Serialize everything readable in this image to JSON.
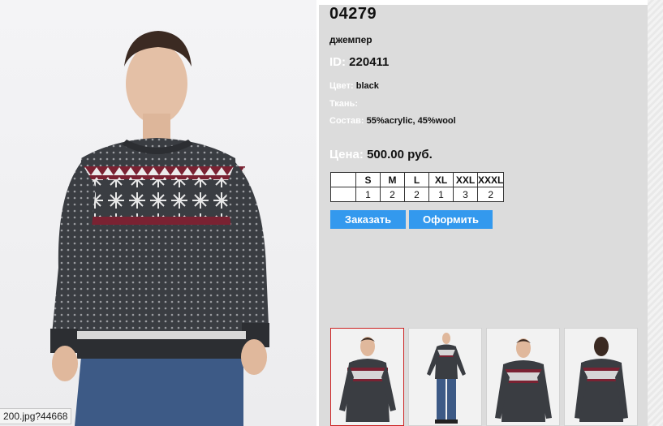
{
  "product": {
    "code": "04279",
    "type": "джемпер",
    "id_label": "ID:",
    "id_value": "220411",
    "color_label": "Цвет:",
    "color_value": "black",
    "fabric_label": "Ткань:",
    "fabric_value": "",
    "composition_label": "Состав:",
    "composition_value": "55%acrylic, 45%wool",
    "price_label": "Цена:",
    "price_value": "500.00 руб."
  },
  "sizes": {
    "headers": [
      "S",
      "M",
      "L",
      "XL",
      "XXL",
      "XXXL"
    ],
    "quantities": [
      "1",
      "2",
      "2",
      "1",
      "3",
      "2"
    ]
  },
  "buttons": {
    "order": "Заказать",
    "checkout": "Оформить"
  },
  "status_url": "200.jpg?44668",
  "colors": {
    "panel_bg": "#dcdcdc",
    "button_bg": "#3399ee",
    "label_color": "#ffffff",
    "sweater_dark": "#3a3d42",
    "sweater_accent": "#7a2232",
    "active_thumb_border": "#cc2222"
  },
  "thumbnails": [
    {
      "name": "front-view",
      "active": true
    },
    {
      "name": "full-length-view",
      "active": false
    },
    {
      "name": "front-view-2",
      "active": false
    },
    {
      "name": "back-view",
      "active": false
    }
  ]
}
